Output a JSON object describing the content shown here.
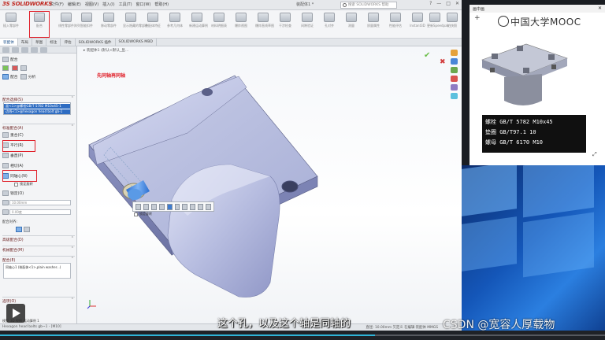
{
  "app": {
    "brand": "SOLIDWORKS",
    "menu": [
      "文件(F)",
      "编辑(E)",
      "视图(V)",
      "插入(I)",
      "工具(T)",
      "窗口(W)",
      "帮助(H)"
    ],
    "doc_title": "装配体1 *",
    "search_placeholder": "搜索 SOLIDWORKS 帮助",
    "win_controls": [
      "?",
      "—",
      "□",
      "✕"
    ]
  },
  "ribbon": {
    "buttons": [
      "插入零部件",
      "配合",
      "线性零部件阵列",
      "智能扣件",
      "移动零部件",
      "显示隐藏的零部件",
      "装配体特征",
      "参考几何体",
      "新建运动算例",
      "材料明细表",
      "爆炸视图",
      "爆炸直线草图",
      "干涉检查",
      "间隙验证",
      "孔对齐",
      "测量",
      "质量属性",
      "性能评估",
      "Instant3D",
      "更新Speedpak",
      "拍快照",
      "Large Assembly Mode"
    ],
    "highlighted_index": 1
  },
  "tabs": [
    "装配体",
    "布局",
    "草图",
    "标注",
    "评估",
    "SOLIDWORKS 插件",
    "SOLIDWORKS MBD"
  ],
  "pm": {
    "title": "配合",
    "tabs": [
      "配合",
      "分析"
    ],
    "sections": {
      "selections": "配合选择(S)",
      "standard": "标准配合(A)",
      "advanced": "高级配合(D)",
      "mechanical": "机械配合(M)",
      "mates": "配合(E)",
      "options": "选项(O)"
    },
    "selection_lines": [
      "面<1>@螺栓GB/T 5782 M10x45-1",
      "边线<1>@hexagon head bolt gb-1"
    ],
    "standard_items": [
      "重合(C)",
      "平行(R)",
      "垂直(P)",
      "相切(A)",
      "同轴心(N)",
      "锁定(O)",
      "距离",
      "角度"
    ],
    "concentric_sub": "锁定旋转",
    "distance_value": "10.00mm",
    "angle_value": "0.00度",
    "align_label": "配合对齐:",
    "mates_list_item": "同轴心1 (装配体<1>,plain washer...)"
  },
  "graphics": {
    "tree_label": "装配体1 (默认<默认_显...",
    "note": "先同轴再同轴",
    "ctx_checkbox": "锁定旋转"
  },
  "status": {
    "left": "Hexagon head bolts gb~1 - [M10]",
    "right": "直径: 10.00mm  欠定义  在编辑 装配体  MMGS"
  },
  "bottom_tabs": [
    "模型",
    "3D 视图",
    "运动算例 1"
  ],
  "video": {
    "top_label": "画中画",
    "mooc_label": "中国大学MOOC",
    "spec_lines": [
      "螺栓 GB/T 5782 M10x45",
      "垫圈 GB/T97.1 10",
      "螺母 GB/T 6170 M10"
    ]
  },
  "player": {
    "subtitle": "这个孔，以及这个轴是同轴的",
    "watermark": "CSDN @宽容人厚载物",
    "progress": 0.62
  },
  "colors": {
    "highlight_red": "#e0202a",
    "accent_blue": "#2e6cc2",
    "progress_cyan": "#2fb4d8"
  }
}
